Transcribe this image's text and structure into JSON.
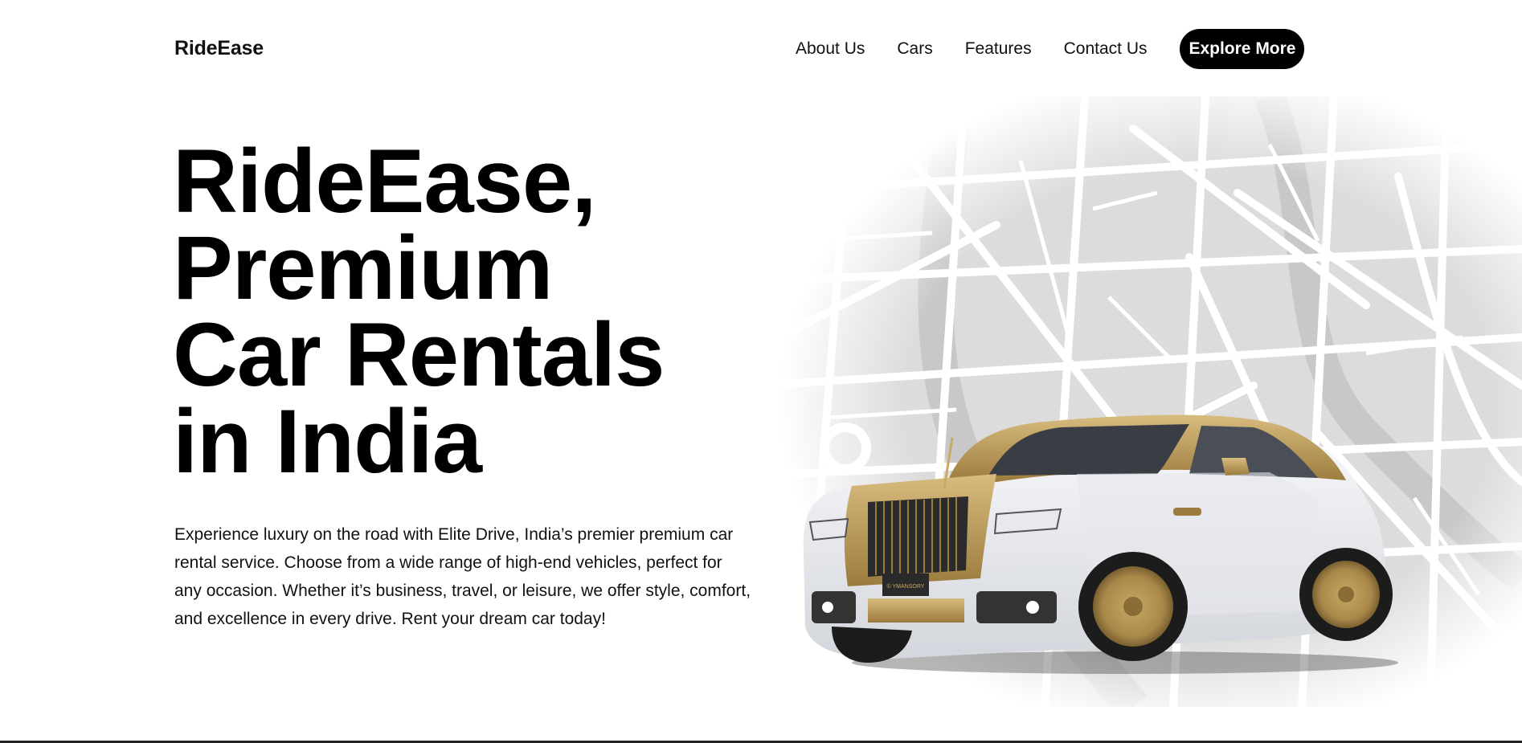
{
  "header": {
    "logo": "RideEase",
    "nav": [
      {
        "label": "About Us"
      },
      {
        "label": "Cars"
      },
      {
        "label": "Features"
      },
      {
        "label": "Contact Us"
      }
    ],
    "cta_label": "Explore More"
  },
  "hero": {
    "title_lines": [
      "RideEase,",
      "Premium",
      "Car Rentals",
      "in India"
    ],
    "description": "Experience luxury on the road with Elite Drive, India’s premier premium car rental service. Choose from a wide range of high-end vehicles, perfect for any occasion. Whether it’s business, travel, or leisure, we offer style, comfort, and excellence in every drive. Rent your dream car today!",
    "plate_text": "© YMANSORY"
  },
  "colors": {
    "accent": "#000000",
    "car_gold": "#b8964e",
    "car_white": "#f2f3f5",
    "map_gray": "#dcdcdc"
  }
}
